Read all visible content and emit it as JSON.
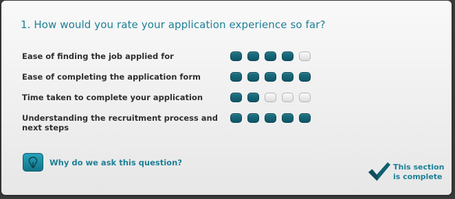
{
  "question": {
    "title": "1. How would you rate your application experience so far?"
  },
  "ratings": [
    {
      "label": "Ease of finding the job applied for",
      "value": 4,
      "max": 5
    },
    {
      "label": "Ease of completing the application form",
      "value": 5,
      "max": 5
    },
    {
      "label": "Time taken to complete your application",
      "value": 2,
      "max": 5
    },
    {
      "label": "Understanding the recruitment process and next steps",
      "value": 5,
      "max": 5
    }
  ],
  "help": {
    "label": "Why do we ask this question?",
    "icon": "lightbulb-icon"
  },
  "status": {
    "label": "This section\nis complete",
    "icon": "checkmark-icon"
  },
  "colors": {
    "accent": "#1d7f96",
    "dot_on": "#135f70",
    "dot_off": "#e8e8e8",
    "text": "#2f2f2f"
  }
}
